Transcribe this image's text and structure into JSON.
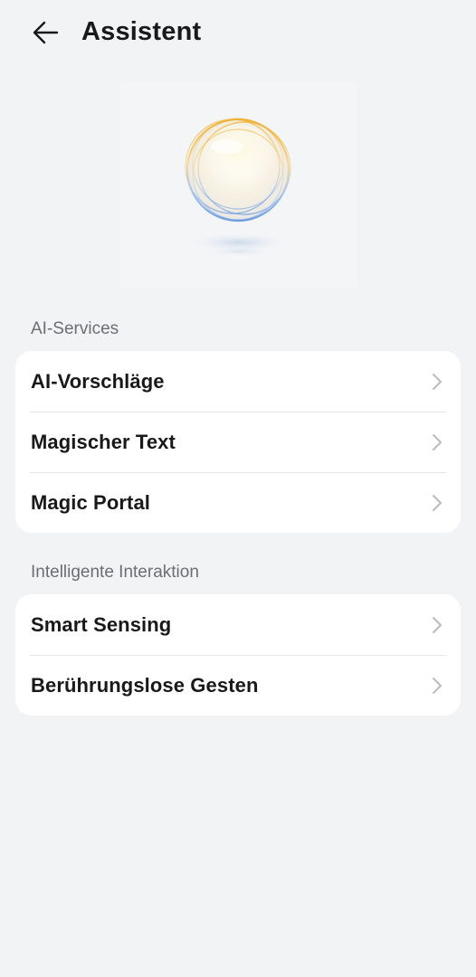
{
  "header": {
    "title": "Assistent",
    "back_icon": "arrow-left-icon"
  },
  "hero": {
    "image": "assistant-orb-illustration"
  },
  "sections": [
    {
      "title": "AI-Services",
      "items": [
        {
          "label": "AI-Vorschläge"
        },
        {
          "label": "Magischer Text"
        },
        {
          "label": "Magic Portal"
        }
      ]
    },
    {
      "title": "Intelligente Interaktion",
      "items": [
        {
          "label": "Smart Sensing"
        },
        {
          "label": "Berührungslose Gesten"
        }
      ]
    }
  ],
  "colors": {
    "background": "#f1f3f5",
    "card": "#ffffff",
    "text_primary": "#191919",
    "text_secondary": "#6b6e73",
    "chevron": "#b8bbbf"
  }
}
